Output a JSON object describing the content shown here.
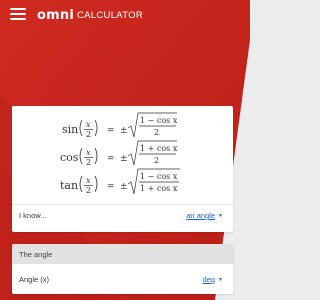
{
  "header": {
    "brand": "omni",
    "product": "CALCULATOR",
    "background": "#c7261d"
  },
  "formulas": [
    {
      "func": "sin",
      "num": "x",
      "den": "2",
      "eq": "=",
      "pm": "±",
      "rad_num": "1 − cos x",
      "rad_den": "2"
    },
    {
      "func": "cos",
      "num": "x",
      "den": "2",
      "eq": "=",
      "pm": "±",
      "rad_num": "1 + cos x",
      "rad_den": "2"
    },
    {
      "func": "tan",
      "num": "x",
      "den": "2",
      "eq": "=",
      "pm": "±",
      "rad_num": "1 − cos x",
      "rad_den": "1 + cos x"
    }
  ],
  "know_row": {
    "label": "I know...",
    "value": "an angle"
  },
  "angle_section": {
    "title": "The angle",
    "field_label": "Angle (x)",
    "unit": "deg"
  },
  "colors": {
    "link": "#1e62c8",
    "brand_red": "#c7261d"
  }
}
